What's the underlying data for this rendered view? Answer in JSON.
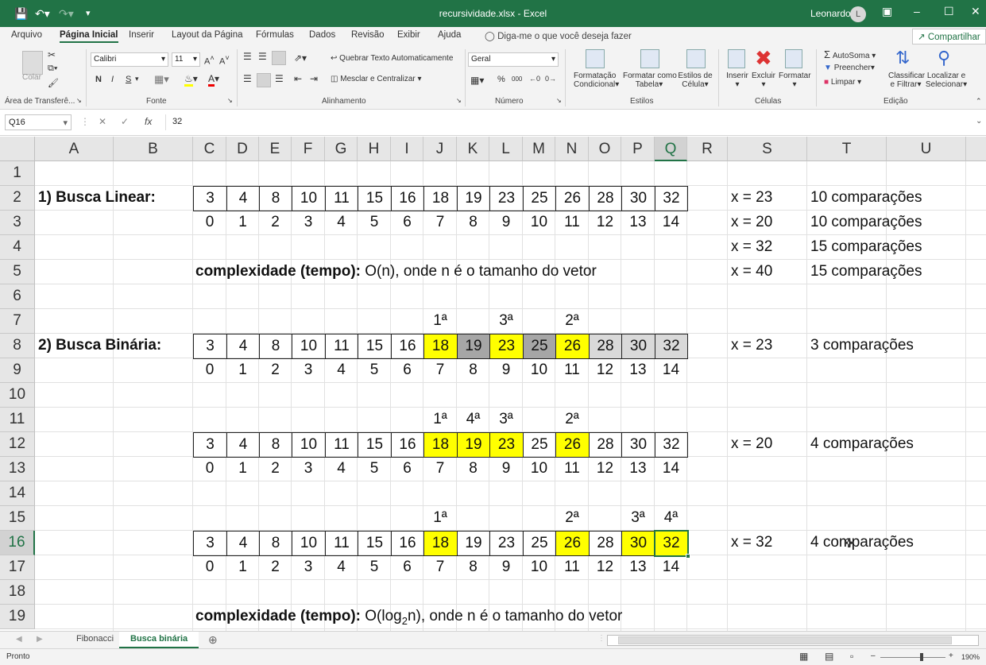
{
  "app": {
    "filename": "recursividade.xlsx",
    "separator": " - ",
    "appname": "Excel",
    "user": "Leonardo",
    "avatar": "L"
  },
  "menu": [
    "Arquivo",
    "Página Inicial",
    "Inserir",
    "Layout da Página",
    "Fórmulas",
    "Dados",
    "Revisão",
    "Exibir",
    "Ajuda"
  ],
  "tellme": "Diga-me o que você deseja fazer",
  "share": "Compartilhar",
  "ribbon": {
    "paste": "Colar",
    "clipboard": "Área de Transferê...",
    "font_group": "Fonte",
    "align_group": "Alinhamento",
    "number_group": "Número",
    "styles_group": "Estilos",
    "cells_group": "Células",
    "edit_group": "Edição",
    "font_name": "Calibri",
    "font_size": "11",
    "wrap": "Quebrar Texto Automaticamente",
    "merge": "Mesclar e Centralizar",
    "number_format": "Geral",
    "cond_fmt_1": "Formatação",
    "cond_fmt_2": "Condicional",
    "table_fmt_1": "Formatar como",
    "table_fmt_2": "Tabela",
    "cell_styles_1": "Estilos de",
    "cell_styles_2": "Célula",
    "insert": "Inserir",
    "delete": "Excluir",
    "format": "Formatar",
    "autosum": "AutoSoma",
    "fill": "Preencher",
    "clear": "Limpar",
    "sort_1": "Classificar",
    "sort_2": "e Filtrar",
    "find_1": "Localizar e",
    "find_2": "Selecionar",
    "bold": "N",
    "italic": "I",
    "underline": "S",
    "percent": "%",
    "thousands": "000"
  },
  "formula": {
    "namebox": "Q16",
    "fx": "fx",
    "value": "32"
  },
  "columns": [
    "A",
    "B",
    "C",
    "D",
    "E",
    "F",
    "G",
    "H",
    "I",
    "J",
    "K",
    "L",
    "M",
    "N",
    "O",
    "P",
    "Q",
    "R",
    "S",
    "T",
    "U"
  ],
  "rows": [
    "1",
    "2",
    "3",
    "4",
    "5",
    "6",
    "7",
    "8",
    "9",
    "10",
    "11",
    "12",
    "13",
    "14",
    "15",
    "16",
    "17",
    "18",
    "19"
  ],
  "sheet": {
    "title_linear": "1) Busca Linear:",
    "title_binary": "2) Busca Binária:",
    "vector": [
      "3",
      "4",
      "8",
      "10",
      "11",
      "15",
      "16",
      "18",
      "19",
      "23",
      "25",
      "26",
      "28",
      "30",
      "32"
    ],
    "indices": [
      "0",
      "1",
      "2",
      "3",
      "4",
      "5",
      "6",
      "7",
      "8",
      "9",
      "10",
      "11",
      "12",
      "13",
      "14"
    ],
    "complexity_linear": {
      "bold": "complexidade (tempo):",
      "rest": " O(n), onde n é o tamanho do vetor"
    },
    "complexity_binary": {
      "bold": "complexidade (tempo):",
      "pre": " O(log",
      "sub": "2",
      "post": "n), onde n é o tamanho do vetor"
    },
    "linear_results": [
      {
        "x": "x = 23",
        "comp": "10 comparações"
      },
      {
        "x": "x = 20",
        "comp": "10 comparações"
      },
      {
        "x": "x = 32",
        "comp": "15 comparações"
      },
      {
        "x": "x = 40",
        "comp": "15 comparações"
      }
    ],
    "binary1": {
      "x": "x = 23",
      "comp": "3 comparações",
      "marks": [
        {
          "col": 7,
          "t": "1ª"
        },
        {
          "col": 9,
          "t": "3ª"
        },
        {
          "col": 11,
          "t": "2ª"
        }
      ],
      "yellow": [
        7,
        9,
        11
      ],
      "gray": [
        8,
        10
      ],
      "lightgray": [
        12,
        13,
        14
      ]
    },
    "binary2": {
      "x": "x = 20",
      "comp": "4 comparações",
      "marks": [
        {
          "col": 7,
          "t": "1ª"
        },
        {
          "col": 8,
          "t": "4ª"
        },
        {
          "col": 9,
          "t": "3ª"
        },
        {
          "col": 11,
          "t": "2ª"
        }
      ],
      "yellow": [
        7,
        8,
        9,
        11
      ]
    },
    "binary3": {
      "x": "x = 32",
      "comp": "4 comparações",
      "marks": [
        {
          "col": 7,
          "t": "1ª"
        },
        {
          "col": 11,
          "t": "2ª"
        },
        {
          "col": 13,
          "t": "3ª"
        },
        {
          "col": 14,
          "t": "4ª"
        }
      ],
      "yellow": [
        7,
        11,
        13,
        14
      ]
    }
  },
  "sheets": [
    "Fibonacci",
    "Busca binária"
  ],
  "status": {
    "ready": "Pronto",
    "zoom": "190%"
  }
}
